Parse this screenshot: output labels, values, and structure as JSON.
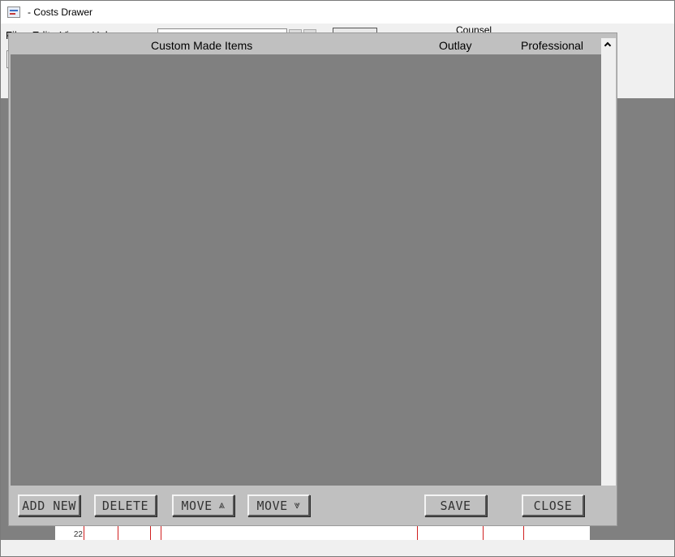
{
  "window": {
    "title": "- Costs Drawer"
  },
  "background": {
    "menu": [
      "File",
      "Edit",
      "View",
      "Help"
    ],
    "counsel_label": "Counsel",
    "row_number": "22"
  },
  "modal": {
    "columns": {
      "items": "Custom Made Items",
      "outlay": "Outlay",
      "professional": "Professional"
    },
    "buttons": {
      "add_new": "ADD NEW",
      "delete": "DELETE",
      "move_up": "MOVE",
      "move_up_glyph": "⩓",
      "move_down": "MOVE",
      "move_down_glyph": "⩔",
      "save": "SAVE",
      "close": "CLOSE"
    }
  },
  "icons": {
    "app": "costs-drawer-app-icon",
    "scroll_up": "chevron-up-icon",
    "scroll_down": "chevron-down-icon"
  },
  "colors": {
    "dialog": "#c0c0c0",
    "list_background": "#808080",
    "grid_lines": "#d02020"
  }
}
